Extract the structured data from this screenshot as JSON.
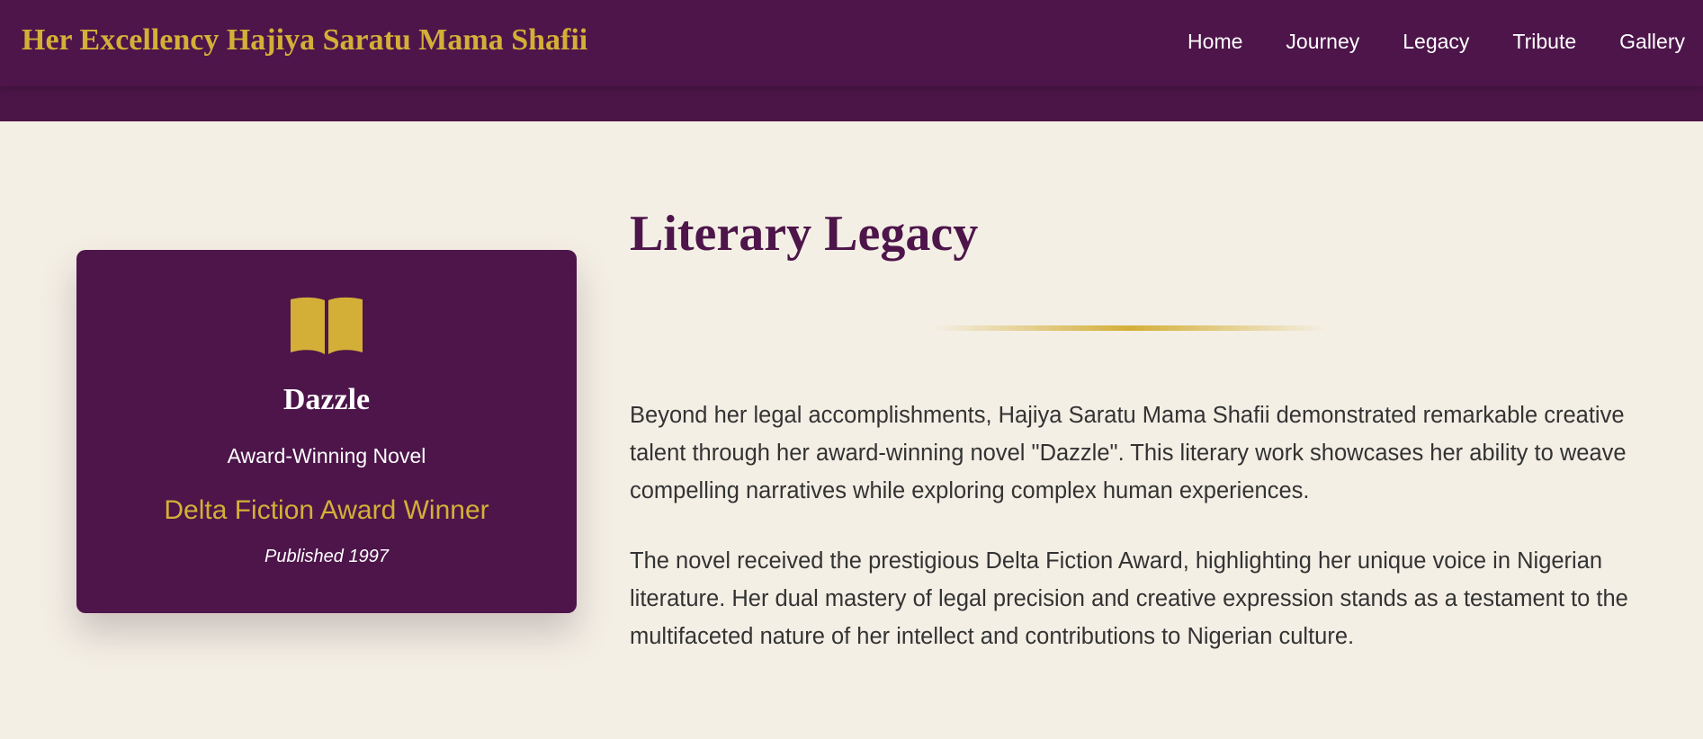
{
  "header": {
    "title": "Her Excellency Hajiya Saratu Mama Shafii",
    "nav": [
      "Home",
      "Journey",
      "Legacy",
      "Tribute",
      "Gallery"
    ]
  },
  "book_card": {
    "icon": "open-book-icon",
    "title": "Dazzle",
    "subtitle": "Award-Winning Novel",
    "award": "Delta Fiction Award Winner",
    "published": "Published 1997"
  },
  "main": {
    "title": "Literary Legacy",
    "paragraphs": [
      "Beyond her legal accomplishments, Hajiya Saratu Mama Shafii demonstrated remarkable creative talent through her award-winning novel \"Dazzle\". This literary work showcases her ability to weave compelling narratives while exploring complex human experiences.",
      "The novel received the prestigious Delta Fiction Award, highlighting her unique voice in Nigerian literature. Her dual mastery of legal precision and creative expression stands as a testament to the multifaceted nature of her intellect and contributions to Nigerian culture."
    ]
  },
  "colors": {
    "primary": "#4d154a",
    "accent": "#d4af37",
    "background": "#f4efe5",
    "text": "#333333"
  }
}
